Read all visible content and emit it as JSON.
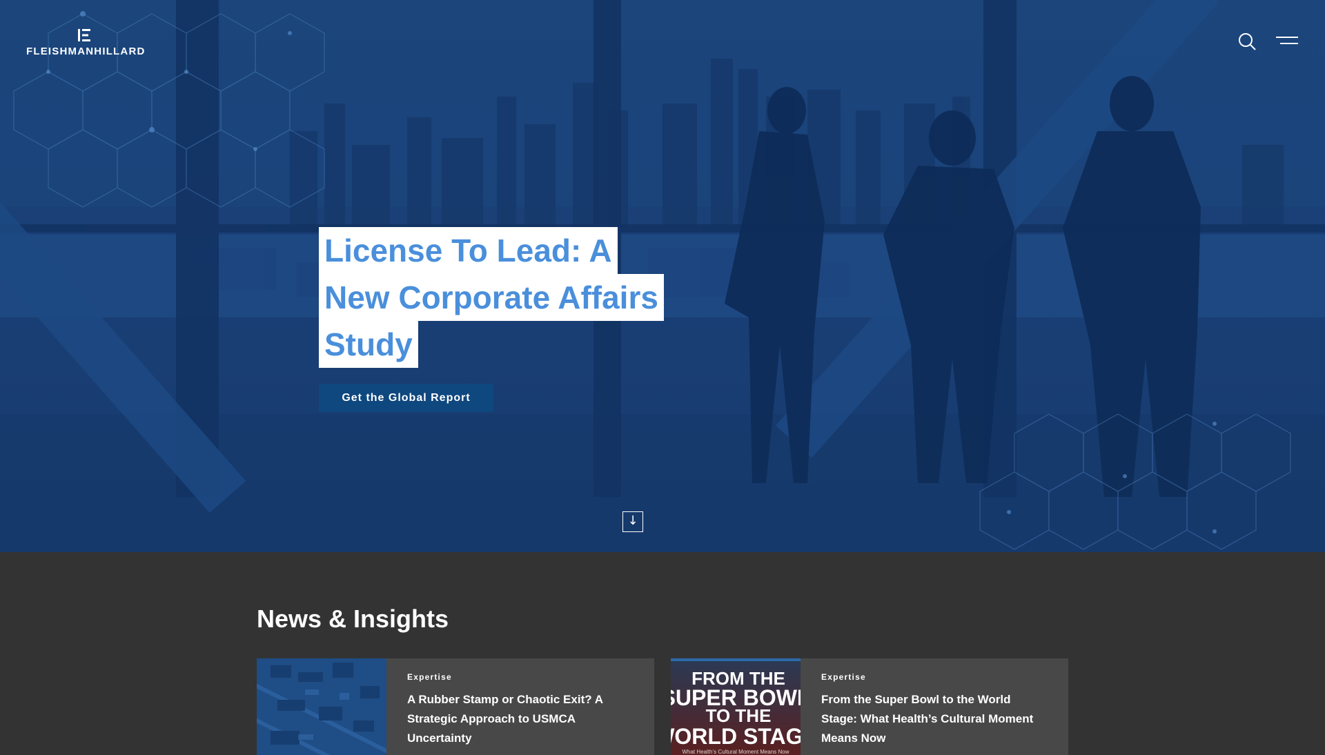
{
  "brand": {
    "name": "FLEISHMANHILLARD"
  },
  "header": {
    "search_icon": "search-icon",
    "menu_icon": "hamburger-menu-icon"
  },
  "hero": {
    "headline_lines": [
      "License To Lead: A",
      "New Corporate Affairs",
      "Study"
    ],
    "cta_label": "Get the Global Report",
    "scroll_icon": "↓",
    "colors": {
      "overlay": "#1a4077",
      "headline_text": "#4a8fdb",
      "cta_bg": "#0f477f"
    }
  },
  "news": {
    "title": "News & Insights",
    "cards": [
      {
        "category": "Expertise",
        "headline": "A Rubber Stamp or Chaotic Exit? A Strategic Approach to USMCA Uncertainty"
      },
      {
        "category": "Expertise",
        "headline": "From the Super Bowl to the World Stage: What Health’s Cultural Moment Means Now",
        "image_text": [
          "FROM THE",
          "SUPER BOWL",
          "TO THE",
          "WORLD STAGE",
          "What Health’s Cultural Moment Means Now"
        ]
      }
    ]
  }
}
